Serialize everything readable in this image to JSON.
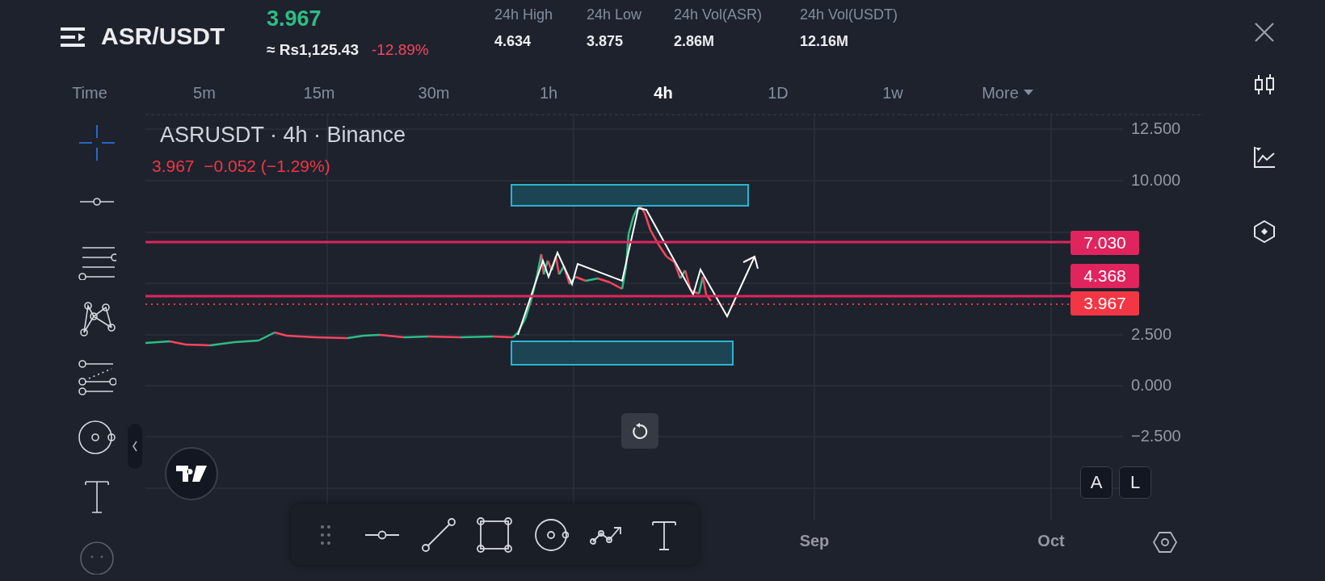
{
  "header": {
    "pair": "ASR/USDT",
    "price": "3.967",
    "fiat_price": "≈ Rs1,125.43",
    "change": "-12.89%",
    "stats": [
      {
        "label": "24h High",
        "value": "4.634"
      },
      {
        "label": "24h Low",
        "value": "3.875"
      },
      {
        "label": "24h Vol(ASR)",
        "value": "2.86M"
      },
      {
        "label": "24h Vol(USDT)",
        "value": "12.16M"
      }
    ]
  },
  "intervals": [
    {
      "label": "Time",
      "selected": false
    },
    {
      "label": "5m",
      "selected": false
    },
    {
      "label": "15m",
      "selected": false
    },
    {
      "label": "30m",
      "selected": false
    },
    {
      "label": "1h",
      "selected": false
    },
    {
      "label": "4h",
      "selected": true
    },
    {
      "label": "1D",
      "selected": false
    },
    {
      "label": "1w",
      "selected": false
    },
    {
      "label": "More",
      "selected": false,
      "kind": "dropdown"
    }
  ],
  "left_tools": [
    {
      "kind": "crosshair",
      "selected": true
    },
    {
      "kind": "horizontal-line",
      "selected": false
    },
    {
      "kind": "channel",
      "selected": false
    },
    {
      "kind": "pattern",
      "selected": false
    },
    {
      "kind": "fib",
      "selected": false
    },
    {
      "kind": "circle",
      "selected": false
    },
    {
      "kind": "text",
      "selected": false
    },
    {
      "kind": "sticker",
      "selected": false
    }
  ],
  "chart": {
    "symbol": "ASRUSDT · 4h · Binance",
    "ohlc": "3.967  −0.052 (−1.29%)",
    "y_labels": [
      "12.500",
      "10.000",
      "2.500",
      "0.000",
      "−2.500"
    ],
    "x_labels": [
      "Sep",
      "Oct"
    ],
    "price_lines": [
      {
        "label": "7.030",
        "kind": "level"
      },
      {
        "label": "4.368",
        "kind": "level"
      },
      {
        "label": "3.967",
        "kind": "last"
      }
    ],
    "scale_buttons": [
      "A",
      "L"
    ]
  },
  "drawing_toolbar": [
    {
      "kind": "handle"
    },
    {
      "kind": "horizontal-line"
    },
    {
      "kind": "trend-line"
    },
    {
      "kind": "rectangle"
    },
    {
      "kind": "circle"
    },
    {
      "kind": "path"
    },
    {
      "kind": "text"
    }
  ]
}
